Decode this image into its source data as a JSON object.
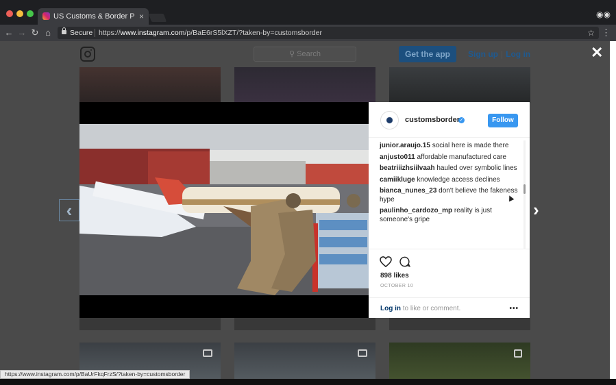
{
  "browser": {
    "tab_title": "US Customs & Border Protec",
    "tab_close": "×",
    "secure_label": "Secure",
    "url_scheme": "https://",
    "url_host": "www.instagram.com",
    "url_path": "/p/BaE6rS5lXZT/?taken-by=customsborder",
    "status_url": "https://www.instagram.com/p/BaUrFkqFrzS/?taken-by=customsborder",
    "icons": [
      "back-icon",
      "forward-icon",
      "reload-icon",
      "home-icon",
      "lock-icon",
      "star-icon",
      "menu-icon",
      "incognito-icon"
    ]
  },
  "header": {
    "search_placeholder": "Search",
    "get_app_label": "Get the app",
    "signup_label": "Sign up",
    "divider": "|",
    "login_label": "Log in",
    "close_glyph": "✕"
  },
  "modal": {
    "prev_glyph": "‹",
    "next_glyph": "›",
    "username": "customsborder",
    "verified_glyph": "✓",
    "follow_label": "Follow",
    "comments": [
      {
        "user": "junior.araujo.15",
        "text": "social here is made there"
      },
      {
        "user": "anjusto011",
        "text": "affordable manufactured care"
      },
      {
        "user": "beatriiizhsiilvaah",
        "text": "hauled over symbolic lines"
      },
      {
        "user": "camiikluge",
        "text": "knowledge access declines"
      },
      {
        "user": "bianca_nunes_23",
        "text": "don't believe the fakeness hype"
      },
      {
        "user": "paulinho_cardozo_mp",
        "text": "reality is just someone's gripe"
      }
    ],
    "likes": "898 likes",
    "date": "OCTOBER 10",
    "login_link": "Log in",
    "login_suffix": "to like or comment.",
    "more_glyph": "•••"
  },
  "colors": {
    "accent": "#3897f0",
    "overlay": "#4a4a4a",
    "link": "#003569"
  }
}
